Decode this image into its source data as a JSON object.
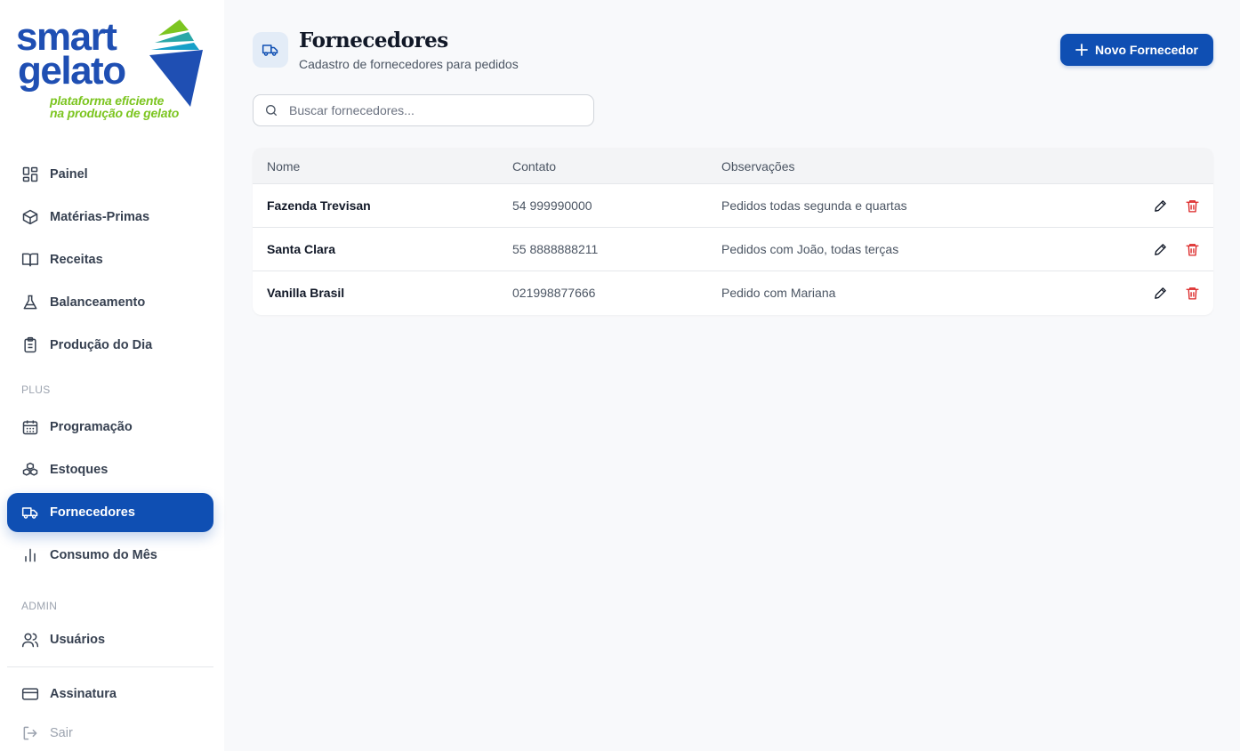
{
  "brand": {
    "line1": "smart",
    "line2": "gelato",
    "tagline1": "plataforma eficiente",
    "tagline2": "na produção de gelato",
    "colors": {
      "primary": "#1f4fb3",
      "accent": "#7cc520",
      "teal": "#2aa7a7"
    }
  },
  "sidebar": {
    "main_items": [
      {
        "label": "Painel",
        "icon": "grid-icon"
      },
      {
        "label": "Matérias-Primas",
        "icon": "box-icon"
      },
      {
        "label": "Receitas",
        "icon": "book-open-icon"
      },
      {
        "label": "Balanceamento",
        "icon": "flask-icon"
      },
      {
        "label": "Produção do Dia",
        "icon": "clipboard-icon"
      }
    ],
    "plus_label": "PLUS",
    "plus_items": [
      {
        "label": "Programação",
        "icon": "calendar-icon"
      },
      {
        "label": "Estoques",
        "icon": "boxes-icon"
      },
      {
        "label": "Fornecedores",
        "icon": "truck-icon",
        "active": true
      },
      {
        "label": "Consumo do Mês",
        "icon": "bar-chart-icon"
      }
    ],
    "admin_label": "ADMIN",
    "admin_items": [
      {
        "label": "Usuários",
        "icon": "users-icon"
      }
    ],
    "footer_items": [
      {
        "label": "Assinatura",
        "icon": "credit-card-icon"
      },
      {
        "label": "Sair",
        "icon": "logout-icon"
      }
    ]
  },
  "header": {
    "title": "Fornecedores",
    "subtitle": "Cadastro de fornecedores para pedidos",
    "new_button_label": "Novo Fornecedor",
    "icon": "truck-icon"
  },
  "search": {
    "placeholder": "Buscar fornecedores...",
    "value": ""
  },
  "table": {
    "columns": [
      "Nome",
      "Contato",
      "Observações"
    ],
    "rows": [
      {
        "nome": "Fazenda Trevisan",
        "contato": "54 999990000",
        "observacoes": "Pedidos todas segunda e quartas"
      },
      {
        "nome": "Santa Clara",
        "contato": "55 8888888211",
        "observacoes": "Pedidos com João, todas terças"
      },
      {
        "nome": "Vanilla Brasil",
        "contato": "021998877666",
        "observacoes": "Pedido com Mariana"
      }
    ]
  },
  "colors": {
    "active_nav": "#0f4fb3",
    "delete": "#dc2626"
  }
}
